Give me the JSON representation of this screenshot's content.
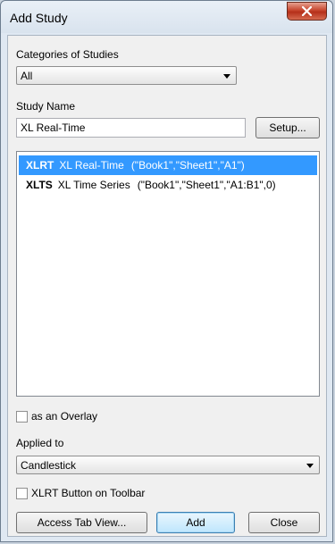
{
  "window": {
    "title": "Add Study"
  },
  "categories": {
    "label": "Categories of Studies",
    "selected": "All"
  },
  "study_name": {
    "label": "Study Name",
    "value": "XL Real-Time",
    "setup_label": "Setup..."
  },
  "studies": [
    {
      "code": "XLRT",
      "name": "XL Real-Time",
      "args": "(\"Book1\",\"Sheet1\",\"A1\")",
      "selected": true
    },
    {
      "code": "XLTS",
      "name": "XL Time Series",
      "args": "(\"Book1\",\"Sheet1\",\"A1:B1\",0)",
      "selected": false
    }
  ],
  "overlay": {
    "label": "as an Overlay",
    "checked": false
  },
  "applied_to": {
    "label": "Applied to",
    "selected": "Candlestick"
  },
  "toolbar_button": {
    "label": "XLRT Button on Toolbar",
    "checked": false
  },
  "buttons": {
    "access_tab": "Access Tab View...",
    "add": "Add",
    "close": "Close"
  },
  "colors": {
    "selection": "#3399ff",
    "close_button": "#c7452d"
  }
}
